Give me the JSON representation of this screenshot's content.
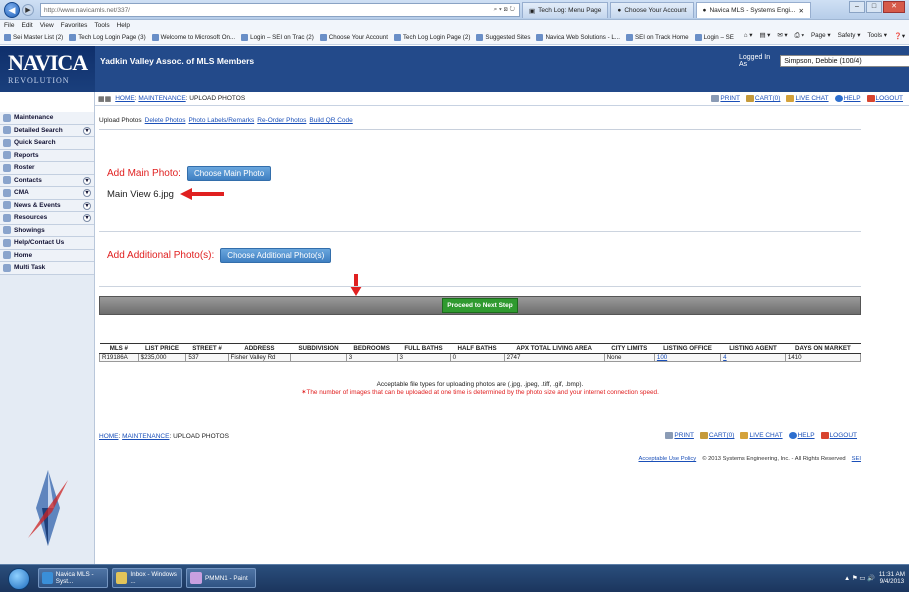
{
  "browser": {
    "url": "http://www.navicamls.net/337/",
    "tabs": [
      {
        "label": "Tech Log: Menu Page",
        "active": false
      },
      {
        "label": "Choose Your Account",
        "active": false
      },
      {
        "label": "Navica MLS - Systems Engi...",
        "active": true
      }
    ],
    "menu": [
      "File",
      "Edit",
      "View",
      "Favorites",
      "Tools",
      "Help"
    ],
    "favorites": [
      "Sei Master List (2)",
      "Tech Log Login Page (3)",
      "Welcome to Microsoft On...",
      "Login – SEI on Trac (2)",
      "Choose Your Account",
      "Tech Log Login Page (2)",
      "Suggested Sites",
      "Navica Web Solutions - L...",
      "SEI on Track Home",
      "Login – SEI on Trac"
    ],
    "commands": [
      "Page ▾",
      "Safety ▾",
      "Tools ▾"
    ]
  },
  "app": {
    "logo": "NAVICA",
    "logo_sub": "REVOLUTION",
    "name": "Yadkin Valley Assoc. of MLS Members",
    "logged_in_label": "Logged In As",
    "user": "Simpson, Debbie (100/4)"
  },
  "breadcrumb": {
    "home": "HOME",
    "maintenance": "MAINTENANCE",
    "current": "UPLOAD PHOTOS"
  },
  "header_links": {
    "print": "PRINT",
    "cart": "CART(0)",
    "live_chat": "LIVE CHAT",
    "help": "HELP",
    "logout": "LOGOUT"
  },
  "sidebar": [
    {
      "label": "Maintenance",
      "expandable": false
    },
    {
      "label": "Detailed Search",
      "expandable": true
    },
    {
      "label": "Quick Search",
      "expandable": false
    },
    {
      "label": "Reports",
      "expandable": false
    },
    {
      "label": "Roster",
      "expandable": false
    },
    {
      "label": "Contacts",
      "expandable": true
    },
    {
      "label": "CMA",
      "expandable": true
    },
    {
      "label": "News & Events",
      "expandable": true
    },
    {
      "label": "Resources",
      "expandable": true
    },
    {
      "label": "Showings",
      "expandable": false
    },
    {
      "label": "Help/Contact Us",
      "expandable": false
    },
    {
      "label": "Home",
      "expandable": false
    },
    {
      "label": "Multi Task",
      "expandable": false
    }
  ],
  "tabs": [
    "Upload Photos",
    "Delete Photos",
    "Photo Labels/Remarks",
    "Re-Order Photos",
    "Build QR Code"
  ],
  "upload": {
    "main_label": "Add Main Photo:",
    "main_button": "Choose Main Photo",
    "main_file": "Main View 6.jpg",
    "additional_label": "Add Additional Photo(s):",
    "additional_button": "Choose Additional Photo(s)",
    "next_button": "Proceed to Next Step"
  },
  "listing_table": {
    "headers": [
      "MLS #",
      "LIST PRICE",
      "STREET #",
      "ADDRESS",
      "SUBDIVISION",
      "BEDROOMS",
      "FULL BATHS",
      "HALF BATHS",
      "APX TOTAL LIVING AREA",
      "CITY LIMITS",
      "LISTING OFFICE",
      "LISTING AGENT",
      "DAYS ON MARKET"
    ],
    "row": [
      "R19186A",
      "$235,000",
      "537",
      "Fisher Valley Rd",
      "",
      "3",
      "3",
      "0",
      "2747",
      "None",
      "100",
      "4",
      "1410"
    ]
  },
  "notes": {
    "filetypes": "Acceptable file types for uploading photos are (.jpg, .jpeg, .tiff, .gif, .bmp).",
    "limit": "The number of images that can be uploaded at one time is determined by the photo size and your internet connection speed."
  },
  "footer": {
    "acceptable_use": "Acceptable Use Policy",
    "copyright": "© 2013 Systems Engineering, Inc. - All Rights Reserved",
    "sei": "SEI"
  },
  "taskbar": {
    "items": [
      "Navica MLS - Syst...",
      "Inbox - Windows ...",
      "PMMN1 - Paint"
    ],
    "time": "11:31 AM",
    "date": "9/4/2013"
  },
  "colors": {
    "accent_red": "#e02020",
    "header_blue": "#234a8a",
    "button_blue": "#3f7fc2",
    "next_green": "#2f9a2f"
  }
}
